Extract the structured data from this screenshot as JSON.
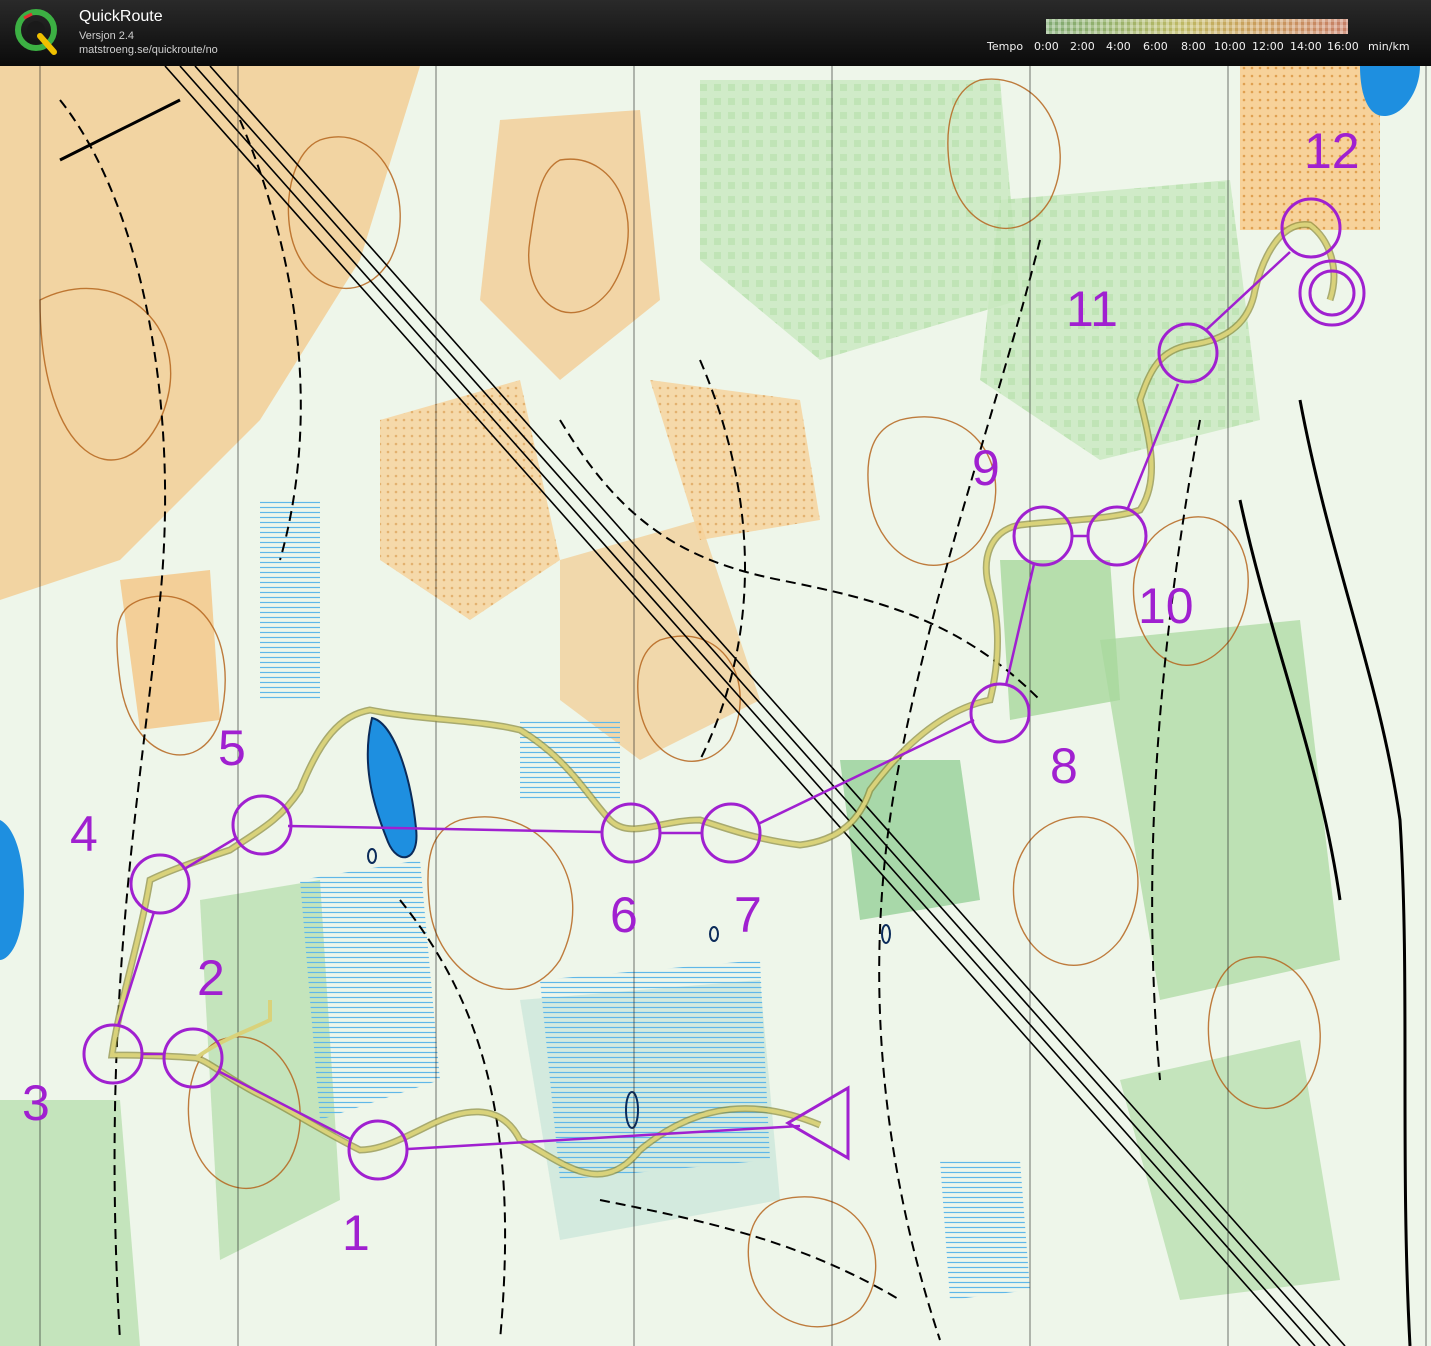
{
  "app": {
    "name": "QuickRoute",
    "version": "Versjon 2.4",
    "url": "matstroeng.se/quickroute/no"
  },
  "legend": {
    "label": "Tempo",
    "ticks": [
      "0:00",
      "2:00",
      "4:00",
      "6:00",
      "8:00",
      "10:00",
      "12:00",
      "14:00",
      "16:00"
    ],
    "unit": "min/km",
    "colors": [
      "#9bcf8a",
      "#e9e27a",
      "#f39a7c"
    ]
  },
  "map": {
    "colors": {
      "forest_green": "#a8d89c",
      "dark_green": "#6fbf73",
      "open_land": "#f5c27a",
      "water": "#1e8fe0",
      "marsh": "#5fb7e8",
      "contour": "#b5651d",
      "course": "#a020d0",
      "route": "#c9c36a"
    },
    "controls": [
      {
        "number": "1"
      },
      {
        "number": "2"
      },
      {
        "number": "3"
      },
      {
        "number": "4"
      },
      {
        "number": "5"
      },
      {
        "number": "6"
      },
      {
        "number": "7"
      },
      {
        "number": "8"
      },
      {
        "number": "9"
      },
      {
        "number": "10"
      },
      {
        "number": "11"
      },
      {
        "number": "12"
      }
    ]
  }
}
